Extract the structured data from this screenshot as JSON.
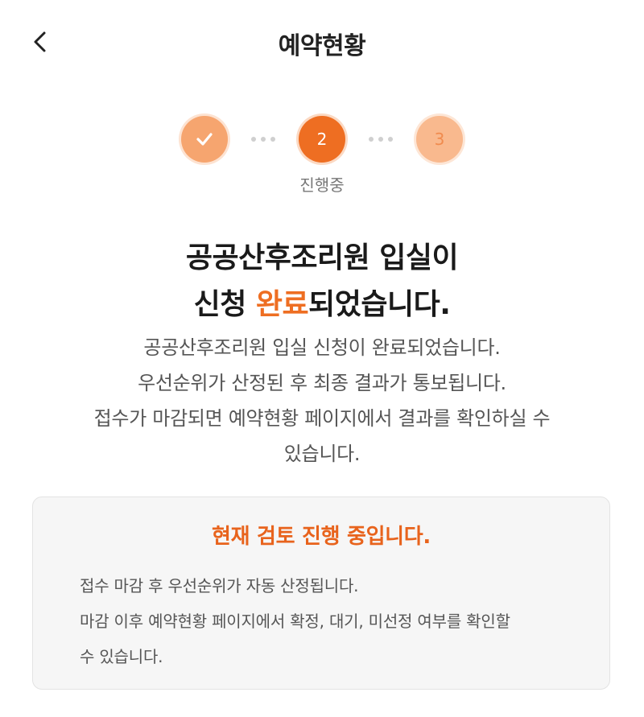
{
  "header": {
    "back_icon": "chevron-left-icon",
    "title": "예약현황"
  },
  "stepper": {
    "steps": [
      {
        "state": "done",
        "icon": "check-icon"
      },
      {
        "state": "current",
        "number": "2"
      },
      {
        "state": "pending",
        "number": "3"
      }
    ],
    "current_label": "진행중",
    "colors": {
      "done": "#f6a56f",
      "current": "#ee6e22",
      "pending": "#f9b98e"
    }
  },
  "headline": {
    "line1": "공공산후조리원 입실이",
    "line2_prefix": "신청 ",
    "line2_accent": "완료",
    "line2_suffix": "되었습니다."
  },
  "description": {
    "lines": [
      "공공산후조리원 입실 신청이 완료되었습니다.",
      "우선순위가 산정된 후 최종 결과가 통보됩니다.",
      "접수가 마감되면 예약현황 페이지에서 결과를 확인하실 수",
      "있습니다."
    ]
  },
  "notice_card": {
    "title": "현재 검토 진행 중입니다.",
    "lines": [
      "접수 마감 후 우선순위가 자동 산정됩니다.",
      "마감 이후 예약현황 페이지에서 확정, 대기, 미선정 여부를 확인할",
      "수 있습니다."
    ]
  },
  "colors": {
    "accent": "#ee6e22"
  }
}
